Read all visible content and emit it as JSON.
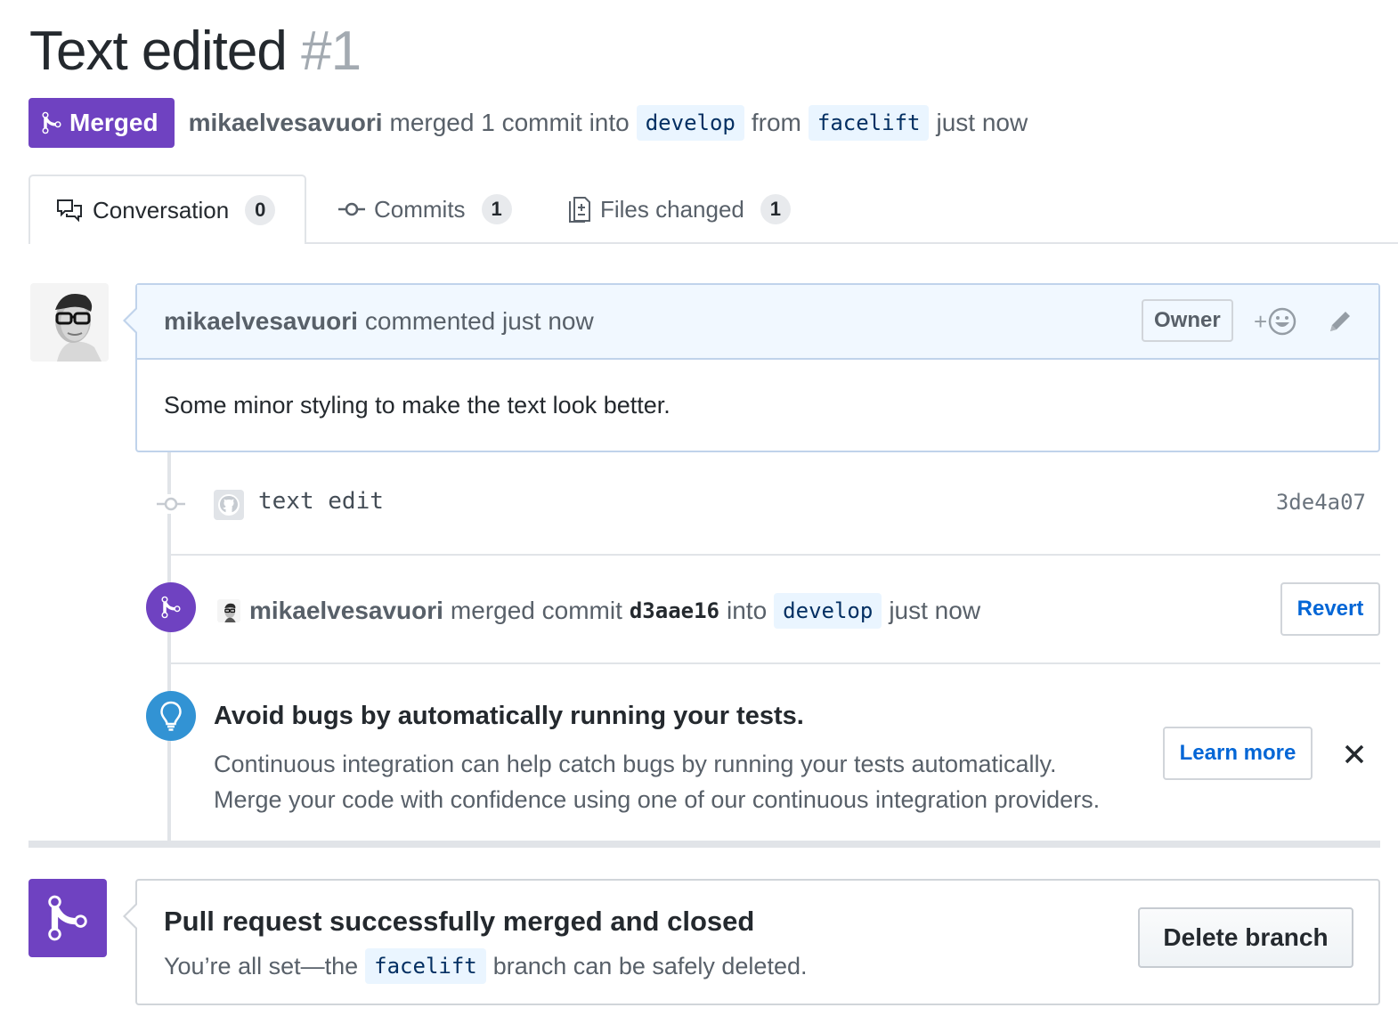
{
  "pr": {
    "title": "Text edited",
    "number": "#1",
    "state_label": "Merged",
    "author": "mikaelvesavuori",
    "summary_mid": "merged 1 commit into",
    "base_branch": "develop",
    "summary_from": "from",
    "head_branch": "facelift",
    "summary_time": "just now"
  },
  "tabs": [
    {
      "label": "Conversation",
      "count": "0"
    },
    {
      "label": "Commits",
      "count": "1"
    },
    {
      "label": "Files changed",
      "count": "1"
    }
  ],
  "comment": {
    "author": "mikaelvesavuori",
    "action": "commented just now",
    "role_badge": "Owner",
    "reaction_plus": "+",
    "body": "Some minor styling to make the text look better."
  },
  "commit": {
    "message": "text edit",
    "sha": "3de4a07"
  },
  "merge_event": {
    "author": "mikaelvesavuori",
    "action": "merged commit",
    "sha": "d3aae16",
    "into": "into",
    "branch": "develop",
    "time": "just now",
    "revert_label": "Revert"
  },
  "ci_tip": {
    "title": "Avoid bugs by automatically running your tests.",
    "line1": "Continuous integration can help catch bugs by running your tests automatically.",
    "line2": "Merge your code with confidence using one of our continuous integration providers.",
    "learn_more_label": "Learn more"
  },
  "merged_box": {
    "title": "Pull request successfully merged and closed",
    "text_before": "You’re all set—the",
    "branch": "facelift",
    "text_after": "branch can be safely deleted.",
    "delete_label": "Delete branch"
  },
  "colors": {
    "merged_purple": "#6f42c1",
    "link_blue": "#0366d6",
    "comment_header_bg": "#f1f8ff",
    "bulb_blue": "#3293d4"
  }
}
